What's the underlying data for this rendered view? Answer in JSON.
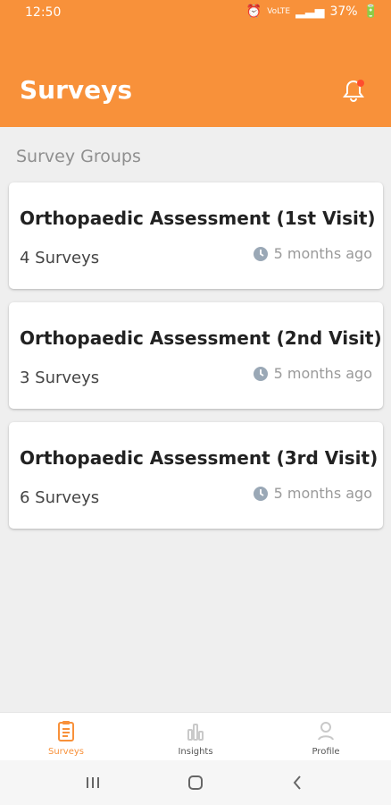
{
  "status": {
    "time": "12:50",
    "battery": "37%",
    "mini": "VoLTE"
  },
  "header": {
    "title": "Surveys"
  },
  "section": {
    "title": "Survey Groups"
  },
  "cards": [
    {
      "title": "Orthopaedic Assessment (1st Visit)",
      "count": "4 Surveys",
      "time": "5 months ago"
    },
    {
      "title": "Orthopaedic Assessment (2nd Visit)",
      "count": "3 Surveys",
      "time": "5 months ago"
    },
    {
      "title": "Orthopaedic Assessment (3rd Visit)",
      "count": "6 Surveys",
      "time": "5 months ago"
    }
  ],
  "tabs": {
    "surveys": "Surveys",
    "insights": "Insights",
    "profile": "Profile"
  },
  "colors": {
    "accent": "#f8913a",
    "notification_dot": "#ff4d2e"
  }
}
